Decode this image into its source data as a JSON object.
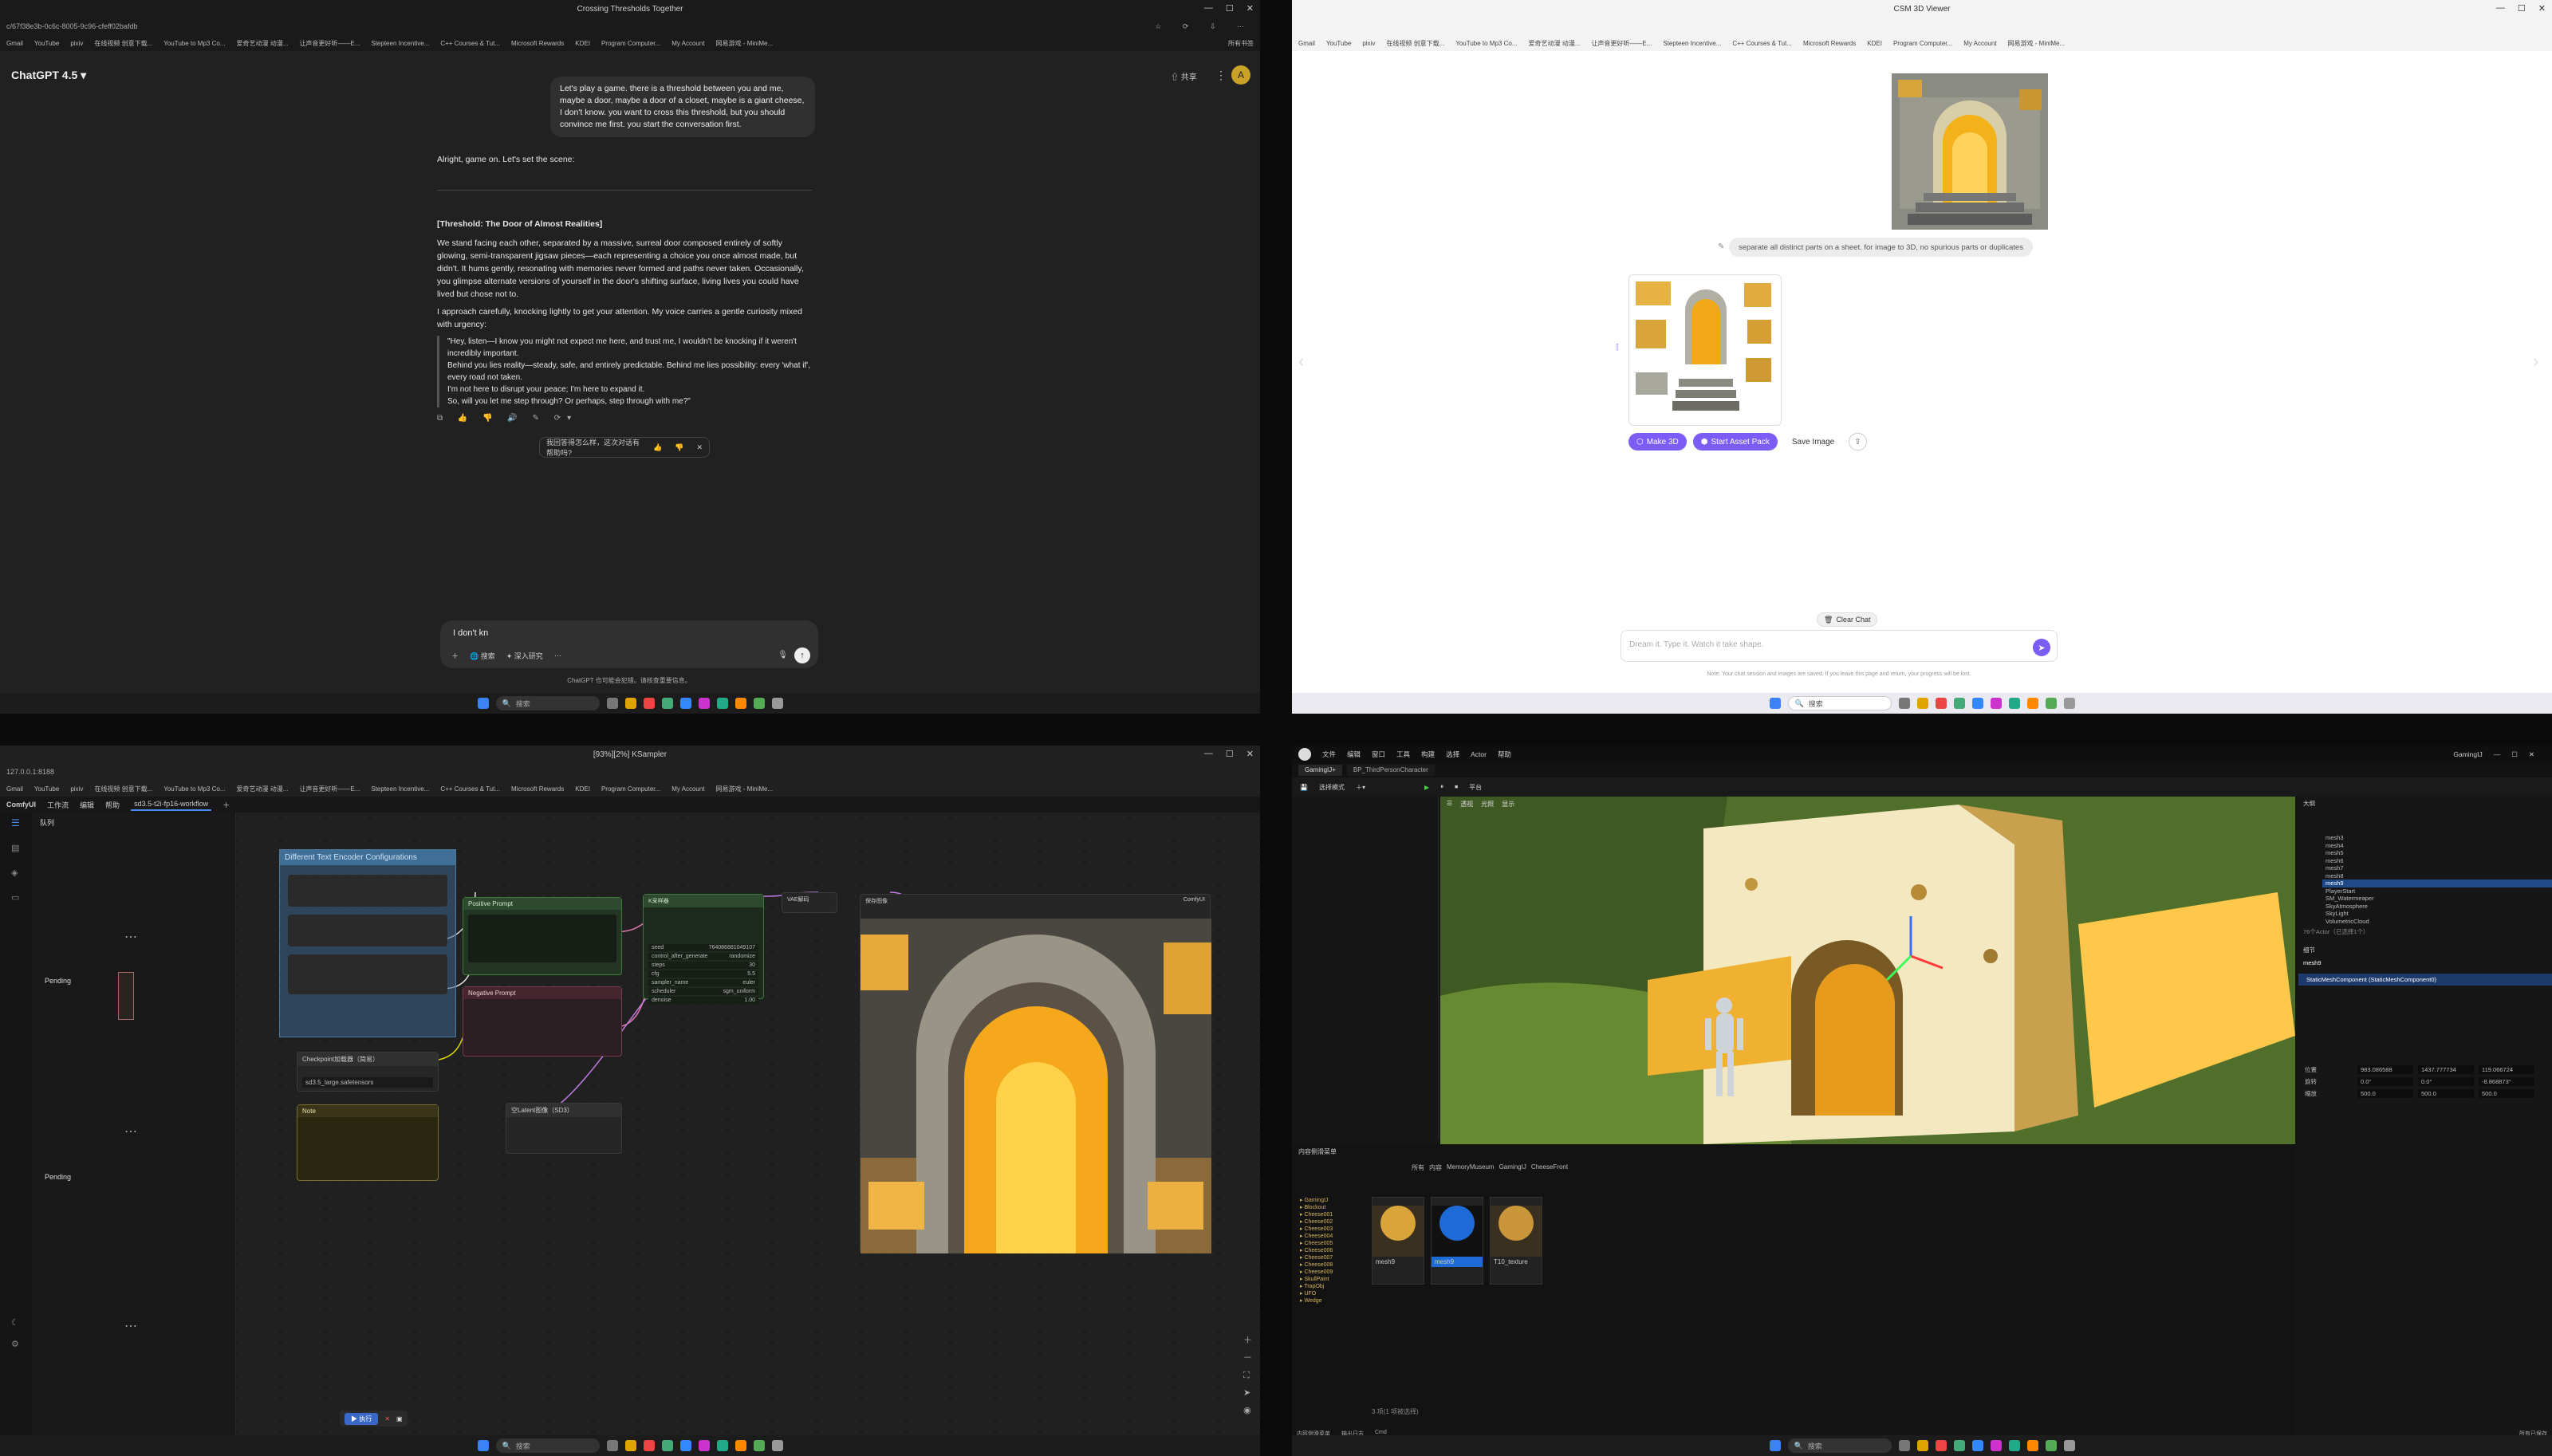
{
  "q1": {
    "window_title": "Crossing Thresholds Together",
    "url": "c/67f38e3b-0c6c-8005-9c96-cfeff02bafdb",
    "bookmarks": [
      "Gmail",
      "YouTube",
      "pixiv",
      "在线视频 创意下载...",
      "YouTube to Mp3 Co...",
      "爱奇艺动漫 动漫...",
      "让声音更好听——E...",
      "Stepteen Incentive...",
      "C++ Courses & Tut...",
      "Microsoft Rewards",
      "KDEI",
      "Program Computer...",
      "My Account",
      "网易游戏 - MiniMe..."
    ],
    "bookmarks_right": "所有书签",
    "model_label": "ChatGPT 4.5",
    "share_label": "共享",
    "avatar_text": "A",
    "user_msg": "Let's play a game. there is a threshold between you and me, maybe a door, maybe a door of a closet, maybe is a giant cheese, I don't know. you want to cross this threshold, but you should convince me first. you start the conversation first.",
    "reply_intro": "Alright, game on. Let's set the scene:",
    "threshold_title": "[Threshold: The Door of Almost Realities]",
    "para1": "We stand facing each other, separated by a massive, surreal door composed entirely of softly glowing, semi-transparent jigsaw pieces—each representing a choice you once almost made, but didn't. It hums gently, resonating with memories never formed and paths never taken. Occasionally, you glimpse alternate versions of yourself in the door's shifting surface, living lives you could have lived but chose not to.",
    "para2": "I approach carefully, knocking lightly to get your attention. My voice carries a gentle curiosity mixed with urgency:",
    "quote": [
      "\"Hey, listen—I know you might not expect me here, and trust me, I wouldn't be knocking if it weren't incredibly important.",
      "Behind you lies reality—steady, safe, and entirely predictable. Behind me lies possibility: every 'what if', every road not taken.",
      "I'm not here to disrupt your peace; I'm here to expand it.",
      "So, will you let me step through? Or perhaps, step through with me?\""
    ],
    "feedback_prompt": "我回答得怎么样，这次对话有帮助吗?",
    "input_text": "I don't kn",
    "tool_search": "搜索",
    "tool_research": "深入研究",
    "disclaimer": "ChatGPT 也可能会犯错。请核查重要信息。",
    "taskbar_search": "搜索"
  },
  "q2": {
    "window_title": "CSM 3D Viewer",
    "prompt_bubble": "separate all distinct parts on a sheet. for image to 3D, no spurious parts or duplicates",
    "btn_make3d": "Make 3D",
    "btn_asset_pack": "Start Asset Pack",
    "btn_save": "Save Image",
    "clear_chat": "Clear Chat",
    "input_placeholder": "Dream it. Type it. Watch it take shape.",
    "footnote": "Note: Your chat session and images are saved. If you leave this page and return, your progress will be lost.",
    "taskbar_search": "搜索"
  },
  "q3": {
    "window_title": "[93%][2%] KSampler",
    "url": "127.0.0.1:8188",
    "app_name": "ComfyUI",
    "menu": [
      "工作流",
      "编辑",
      "帮助"
    ],
    "tab": "sd3.5-t2i-fp16-workflow",
    "queue_label": "队列",
    "pending": [
      "Pending",
      "Pending"
    ],
    "group_title": "Different Text Encoder Configurations",
    "node_positive": "Positive Prompt",
    "node_negative": "Negative Prompt",
    "node_checkpoint": "Checkpoint加载器（简易）",
    "checkpoint_value": "sd3.5_large.safetensors",
    "node_note": "Note",
    "node_latent": "空Latent图像（SD3）",
    "node_ksampler": "K采样器",
    "ksampler_params": [
      [
        "seed",
        "764086881049107"
      ],
      [
        "control_after_generate",
        "randomize"
      ],
      [
        "steps",
        "30"
      ],
      [
        "cfg",
        "5.5"
      ],
      [
        "sampler_name",
        "euler"
      ],
      [
        "scheduler",
        "sgm_uniform"
      ],
      [
        "denoise",
        "1.00"
      ]
    ],
    "node_vae": "VAE解码",
    "node_save": "保存图像",
    "save_prefix": "ComfyUI",
    "run_label": "执行",
    "taskbar_search": "搜索"
  },
  "q4": {
    "menu": [
      "文件",
      "编辑",
      "窗口",
      "工具",
      "构建",
      "选择",
      "Actor",
      "帮助"
    ],
    "project": "GamingIJ",
    "level_tab": "GamingIJ+",
    "asset_tab": "BP_ThirdPersonCharacter",
    "mode": "选择模式",
    "platform": "平台",
    "perspective": "透视",
    "lit": "光照",
    "show": "显示",
    "outliner_title": "大纲",
    "outliner_items": [
      "mesh3",
      "mesh4",
      "mesh5",
      "mesh6",
      "mesh7",
      "mesh8",
      "mesh9",
      "PlayerStart",
      "SM_Watermeaper",
      "SkyAtmosphere",
      "SkyLight",
      "VolumetricCloud"
    ],
    "outliner_count": "76个Actor（已选择1个）",
    "details_title": "细节",
    "details_selected": "mesh9",
    "details_component": "StaticMeshComponent (StaticMeshComponent0)",
    "transform_labels": [
      "位置",
      "旋转",
      "缩放"
    ],
    "transform_values": [
      [
        "983.086588",
        "1437.777734",
        "119.066724"
      ],
      [
        "0.0°",
        "0.0°",
        "-8.868873°"
      ],
      [
        "500.0",
        "500.0",
        "500.0"
      ]
    ],
    "content_drawer": "内容侧滑菜单",
    "path": [
      "所有",
      "内容",
      "MemoryMuseum",
      "GamingIJ",
      "CheeseFront"
    ],
    "assets": [
      "mesh9",
      "mesh9",
      "T10_texture"
    ],
    "folders": [
      "GamingIJ",
      "Blockout",
      "Cheese001",
      "Cheese002",
      "Cheese003",
      "Cheese004",
      "Cheese005",
      "Cheese006",
      "Cheese007",
      "Cheese008",
      "Cheese009",
      "SkullPaint",
      "TrapObj",
      "UFO",
      "Wedge"
    ],
    "item_count": "3 项(1 项被选择)",
    "status": [
      "内容侧滑菜单",
      "输出日志",
      "Cmd"
    ],
    "status_right": "所有已保存",
    "taskbar_search": "搜索"
  }
}
